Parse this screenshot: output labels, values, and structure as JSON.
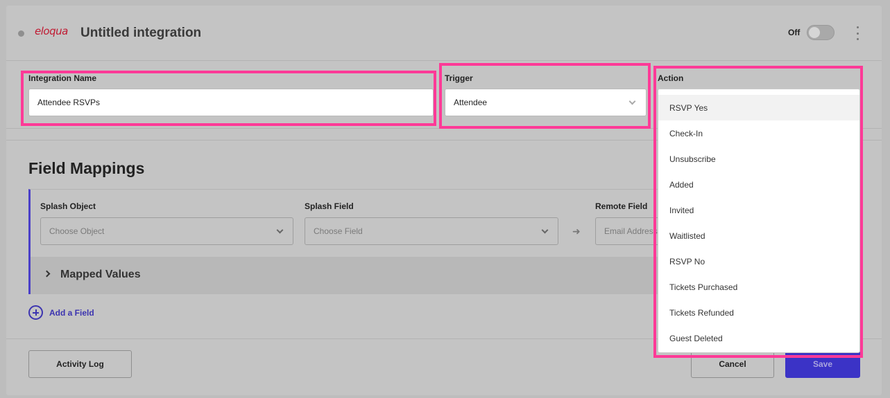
{
  "header": {
    "logo_text": "eloqua",
    "title": "Untitled integration",
    "toggle_label": "Off"
  },
  "settings": {
    "name_label": "Integration Name",
    "name_value": "Attendee RSVPs",
    "trigger_label": "Trigger",
    "trigger_value": "Attendee",
    "action_label": "Action"
  },
  "action_options": [
    "RSVP Yes",
    "Check-In",
    "Unsubscribe",
    "Added",
    "Invited",
    "Waitlisted",
    "RSVP No",
    "Tickets Purchased",
    "Tickets Refunded",
    "Guest Deleted"
  ],
  "mappings": {
    "title": "Field Mappings",
    "splash_object_label": "Splash Object",
    "splash_object_placeholder": "Choose Object",
    "splash_field_label": "Splash Field",
    "splash_field_placeholder": "Choose Field",
    "remote_field_label": "Remote Field",
    "remote_field_placeholder": "Email Address",
    "mapped_values_label": "Mapped Values",
    "add_field_label": "Add a Field"
  },
  "footer": {
    "activity_log_label": "Activity Log",
    "cancel_label": "Cancel",
    "save_label": "Save"
  },
  "colors": {
    "highlight": "#ff3a97",
    "primary": "#3b33c6",
    "brand": "#c01a32"
  }
}
